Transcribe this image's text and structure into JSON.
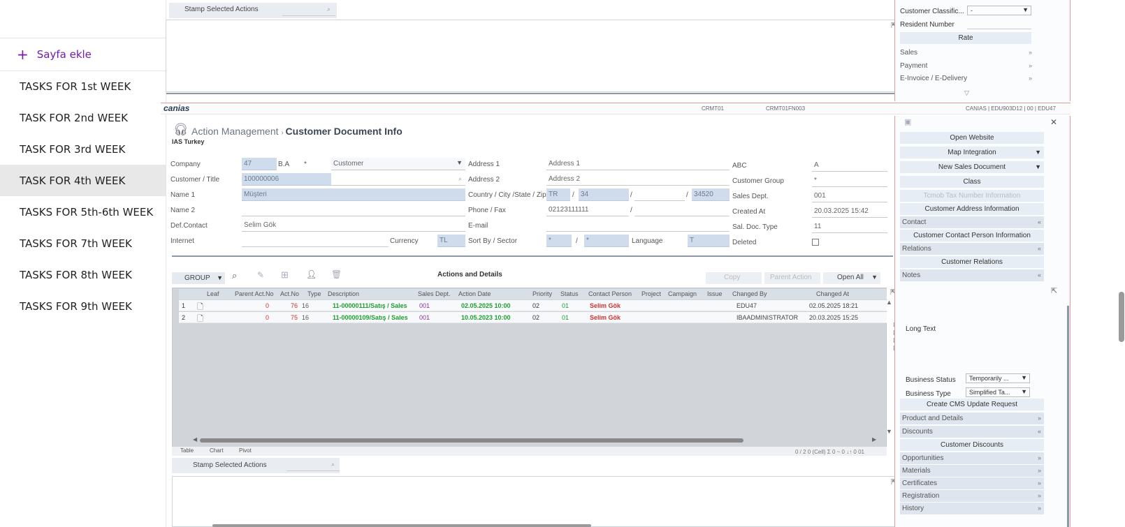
{
  "nav": {
    "add_page": "Sayfa ekle",
    "items": [
      "TASKS FOR 1st WEEK",
      "TASK FOR 2nd WEEK",
      "TASK FOR 3rd WEEK",
      "TASK FOR 4th WEEK",
      "TASKS FOR 5th-6th WEEK",
      "TASKS FOR 7th WEEK",
      "TASKS FOR 8th WEEK",
      "TASKS FOR 9th WEEK"
    ],
    "selected_index": 3
  },
  "top": {
    "stamp_btn": "Stamp Selected Actions",
    "customer_classific_label": "Customer Classific...",
    "customer_classific_value": "-",
    "resident_number_label": "Resident Number",
    "rate_btn": "Rate",
    "sales": "Sales",
    "payment": "Payment",
    "einvoice": "E-Invoice / E-Delivery"
  },
  "brandbar": {
    "logo": "canias",
    "code1": "CRMT01",
    "code2": "CRMT01FN003",
    "session": "CANIAS | EDU903D12 | 00 | EDU47"
  },
  "header": {
    "crumb1": "Action Management",
    "crumb2": "Customer Document Info",
    "company_name": "IAS Turkey"
  },
  "form": {
    "company_label": "Company",
    "company_value": "47",
    "company_ba": "B.A",
    "company_star": "*",
    "company_type": "Customer",
    "customer_label": "Customer / Title",
    "customer_value": "100000006",
    "name1_label": "Name 1",
    "name1_value": "Müşteri",
    "name2_label": "Name 2",
    "defcontact_label": "Def.Contact",
    "defcontact_value": "Selim Gök",
    "internet_label": "Internet",
    "currency_label": "Currency",
    "currency_value": "TL",
    "address1_label": "Address 1",
    "address1_value": "Address 1",
    "address2_label": "Address 2",
    "address2_value": "Address 2",
    "country_label": "Country / City /State / Zip",
    "country_value": "TR",
    "city_value": "34",
    "zip_value": "34520",
    "phone_label": "Phone / Fax",
    "phone_value": "02123111111",
    "email_label": "E-mail",
    "sortby_label": "Sort By / Sector",
    "sortby_value": "*",
    "sector_value": "*",
    "language_label": "Language",
    "language_value": "T",
    "abc_label": "ABC",
    "abc_value": "A",
    "custgroup_label": "Customer Group",
    "custgroup_value": "*",
    "salesdept_label": "Sales Dept.",
    "salesdept_value": "001",
    "createdat_label": "Created At",
    "createdat_value": "20.03.2025 15:42",
    "saldoc_label": "Sal. Doc. Type",
    "saldoc_value": "11",
    "deleted_label": "Deleted"
  },
  "toolbar": {
    "group_btn": "GROUP",
    "title": "Actions and Details",
    "copy_btn": "Copy",
    "parent_action_btn": "Parent Action",
    "open_all_btn": "Open All"
  },
  "grid": {
    "headers": [
      "Leaf",
      "Parent Act.No",
      "Act.No",
      "Type",
      "Description",
      "Sales Dept.",
      "Action Date",
      "Priority",
      "Status",
      "Contact Person",
      "Project",
      "Campaign",
      "Issue",
      "Changed By",
      "Changed At"
    ],
    "rows": [
      {
        "n": "1",
        "parent": "0",
        "actno": "76",
        "type": "16",
        "desc": "11-00000111/Satış / Sales",
        "dept": "001",
        "date": "02.05.2025 10:00",
        "prio": "02",
        "status": "01",
        "contact": "Selim Gök",
        "changedby": "EDU47",
        "changedat": "02.05.2025 18:21"
      },
      {
        "n": "2",
        "parent": "0",
        "actno": "75",
        "type": "16",
        "desc": "11-00000109/Satış / Sales",
        "dept": "001",
        "date": "10.05.2023 10:00",
        "prio": "02",
        "status": "01",
        "contact": "Selim Gök",
        "changedby": "IBAADMINISTRATOR",
        "changedat": "20.03.2025 15:25"
      }
    ],
    "tabs": [
      "Table",
      "Chart",
      "Pivot"
    ],
    "footer": "0 / 2 0 (Cell) Σ 0 ~ 0 ↓↑ 0 01"
  },
  "bottom": {
    "stamp_btn": "Stamp Selected Actions"
  },
  "right": {
    "open_website": "Open Website",
    "map_integration": "Map Integration",
    "new_sales_doc": "New Sales Document",
    "class_btn": "Class",
    "tcmob": "Tcmob Tax Number Information",
    "cust_addr": "Customer Address Information",
    "contact": "Contact",
    "cust_contact": "Customer Contact Person Information",
    "relations": "Relations",
    "cust_relations": "Customer Relations",
    "notes": "Notes",
    "long_text": "Long Text",
    "business_status_label": "Business Status",
    "business_status_value": "Temporarily ...",
    "business_type_label": "Business Type",
    "business_type_value": "Simplified Ta...",
    "create_cms": "Create CMS Update Request",
    "product_details": "Product and Details",
    "discounts": "Discounts",
    "cust_discounts": "Customer Discounts",
    "opportunities": "Opportunities",
    "materials": "Materials",
    "certificates": "Certificates",
    "registration": "Registration",
    "history": "History"
  }
}
